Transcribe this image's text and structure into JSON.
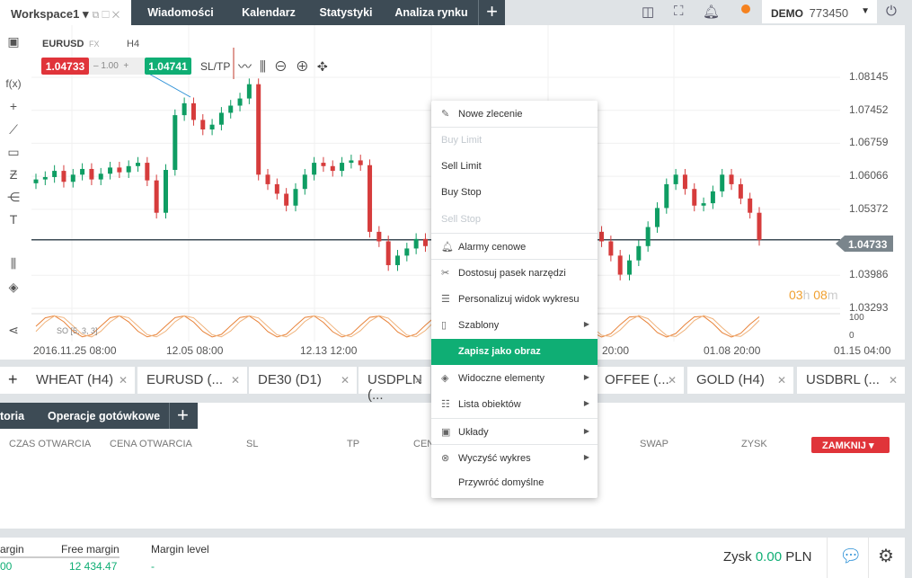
{
  "topbar": {
    "workspace": "Workspace1",
    "tabs": [
      "Wiadomości",
      "Kalendarz",
      "Statystyki",
      "Analiza rynku"
    ],
    "account_type": "DEMO",
    "account_number": "773450",
    "status_color": "#f5821f"
  },
  "chart": {
    "symbol": "EURUSD",
    "symbol_type": "FX",
    "interval": "H4",
    "sell_price": "1.04733",
    "volume": "1.00",
    "buy_price": "1.04741",
    "sltp": "SL/TP",
    "countdown_h": "03",
    "countdown_m": "08",
    "oscillator_label": "SO [5, 3, 3]",
    "osc_max": "100",
    "osc_min": "0",
    "current_price_label": "1.04733"
  },
  "chart_data": {
    "type": "candlestick",
    "price_ticks": [
      "1.08145",
      "1.07452",
      "1.06759",
      "1.06066",
      "1.05372",
      "1.04733",
      "1.03986",
      "1.03293"
    ],
    "x_ticks": [
      "2016.11.25 08:00",
      "12.05 08:00",
      "12.13 12:00",
      "20:00",
      "01.08 20:00",
      "01.15 04:00"
    ],
    "ylim": [
      1.03293,
      1.08145
    ],
    "close": [
      1.06,
      1.0605,
      1.0618,
      1.0595,
      1.061,
      1.0622,
      1.06,
      1.0612,
      1.0625,
      1.0615,
      1.0628,
      1.0635,
      1.0598,
      1.053,
      1.062,
      1.0735,
      1.076,
      1.0725,
      1.0705,
      1.0715,
      1.074,
      1.0755,
      1.077,
      1.08,
      1.061,
      1.059,
      1.057,
      1.0545,
      1.058,
      1.061,
      1.0635,
      1.0628,
      1.0618,
      1.0635,
      1.064,
      1.063,
      1.049,
      1.047,
      1.042,
      1.044,
      1.0455,
      1.0475,
      1.046,
      1.043,
      1.0415,
      1.0395,
      1.041,
      1.043,
      1.045,
      1.046,
      1.047,
      1.048,
      1.049,
      1.05,
      1.051,
      1.0505,
      1.0515,
      1.0525,
      1.052,
      1.051,
      1.049,
      1.047,
      1.044,
      1.04,
      1.043,
      1.046,
      1.05,
      1.054,
      1.059,
      1.061,
      1.058,
      1.0545,
      1.055,
      1.0575,
      1.061,
      1.059,
      1.056,
      1.053,
      1.0473
    ]
  },
  "instrument_tabs": [
    "WHEAT (H4)",
    "EURUSD (...",
    "DE30 (D1)",
    "USDPLN (...",
    "OFFEE (...",
    "GOLD (H4)",
    "USDBRL (..."
  ],
  "bottom": {
    "tabs": [
      "toria",
      "Operacje gotówkowe"
    ],
    "columns": [
      "CZAS OTWARCIA",
      "CENA OTWARCIA",
      "SL",
      "TP",
      "CEN",
      "SWAP",
      "ZYSK"
    ],
    "close_button": "ZAMKNIJ"
  },
  "footer": {
    "margin_label": "argin",
    "margin_value": "00",
    "free_margin_label": "Free margin",
    "free_margin_value": "12 434.47",
    "margin_level_label": "Margin level",
    "margin_level_value": "-",
    "profit_label": "Zysk",
    "profit_value": "0.00",
    "currency": "PLN"
  },
  "context_menu": [
    {
      "label": "Nowe zlecenie",
      "icon": "edit-icon"
    },
    {
      "label": "Buy Limit",
      "disabled": true,
      "sep": true
    },
    {
      "label": "Sell Limit"
    },
    {
      "label": "Buy Stop"
    },
    {
      "label": "Sell Stop",
      "disabled": true
    },
    {
      "label": "Alarmy cenowe",
      "icon": "bell-icon",
      "sep": true
    },
    {
      "label": "Dostosuj pasek narzędzi",
      "icon": "tools-icon",
      "sep": true
    },
    {
      "label": "Personalizuj widok wykresu",
      "icon": "sliders-icon"
    },
    {
      "label": "Szablony",
      "icon": "file-icon",
      "sub": true
    },
    {
      "label": "Zapisz jako obraz",
      "active": true
    },
    {
      "label": "Widoczne elementy",
      "icon": "layers-icon",
      "sub": true
    },
    {
      "label": "Lista obiektów",
      "icon": "list-icon",
      "sub": true
    },
    {
      "label": "Układy",
      "icon": "layout-icon",
      "sub": true,
      "sep": true
    },
    {
      "label": "Wyczyść wykres",
      "icon": "clear-icon",
      "sub": true,
      "sep": true
    },
    {
      "label": "Przywróć domyślne"
    }
  ]
}
